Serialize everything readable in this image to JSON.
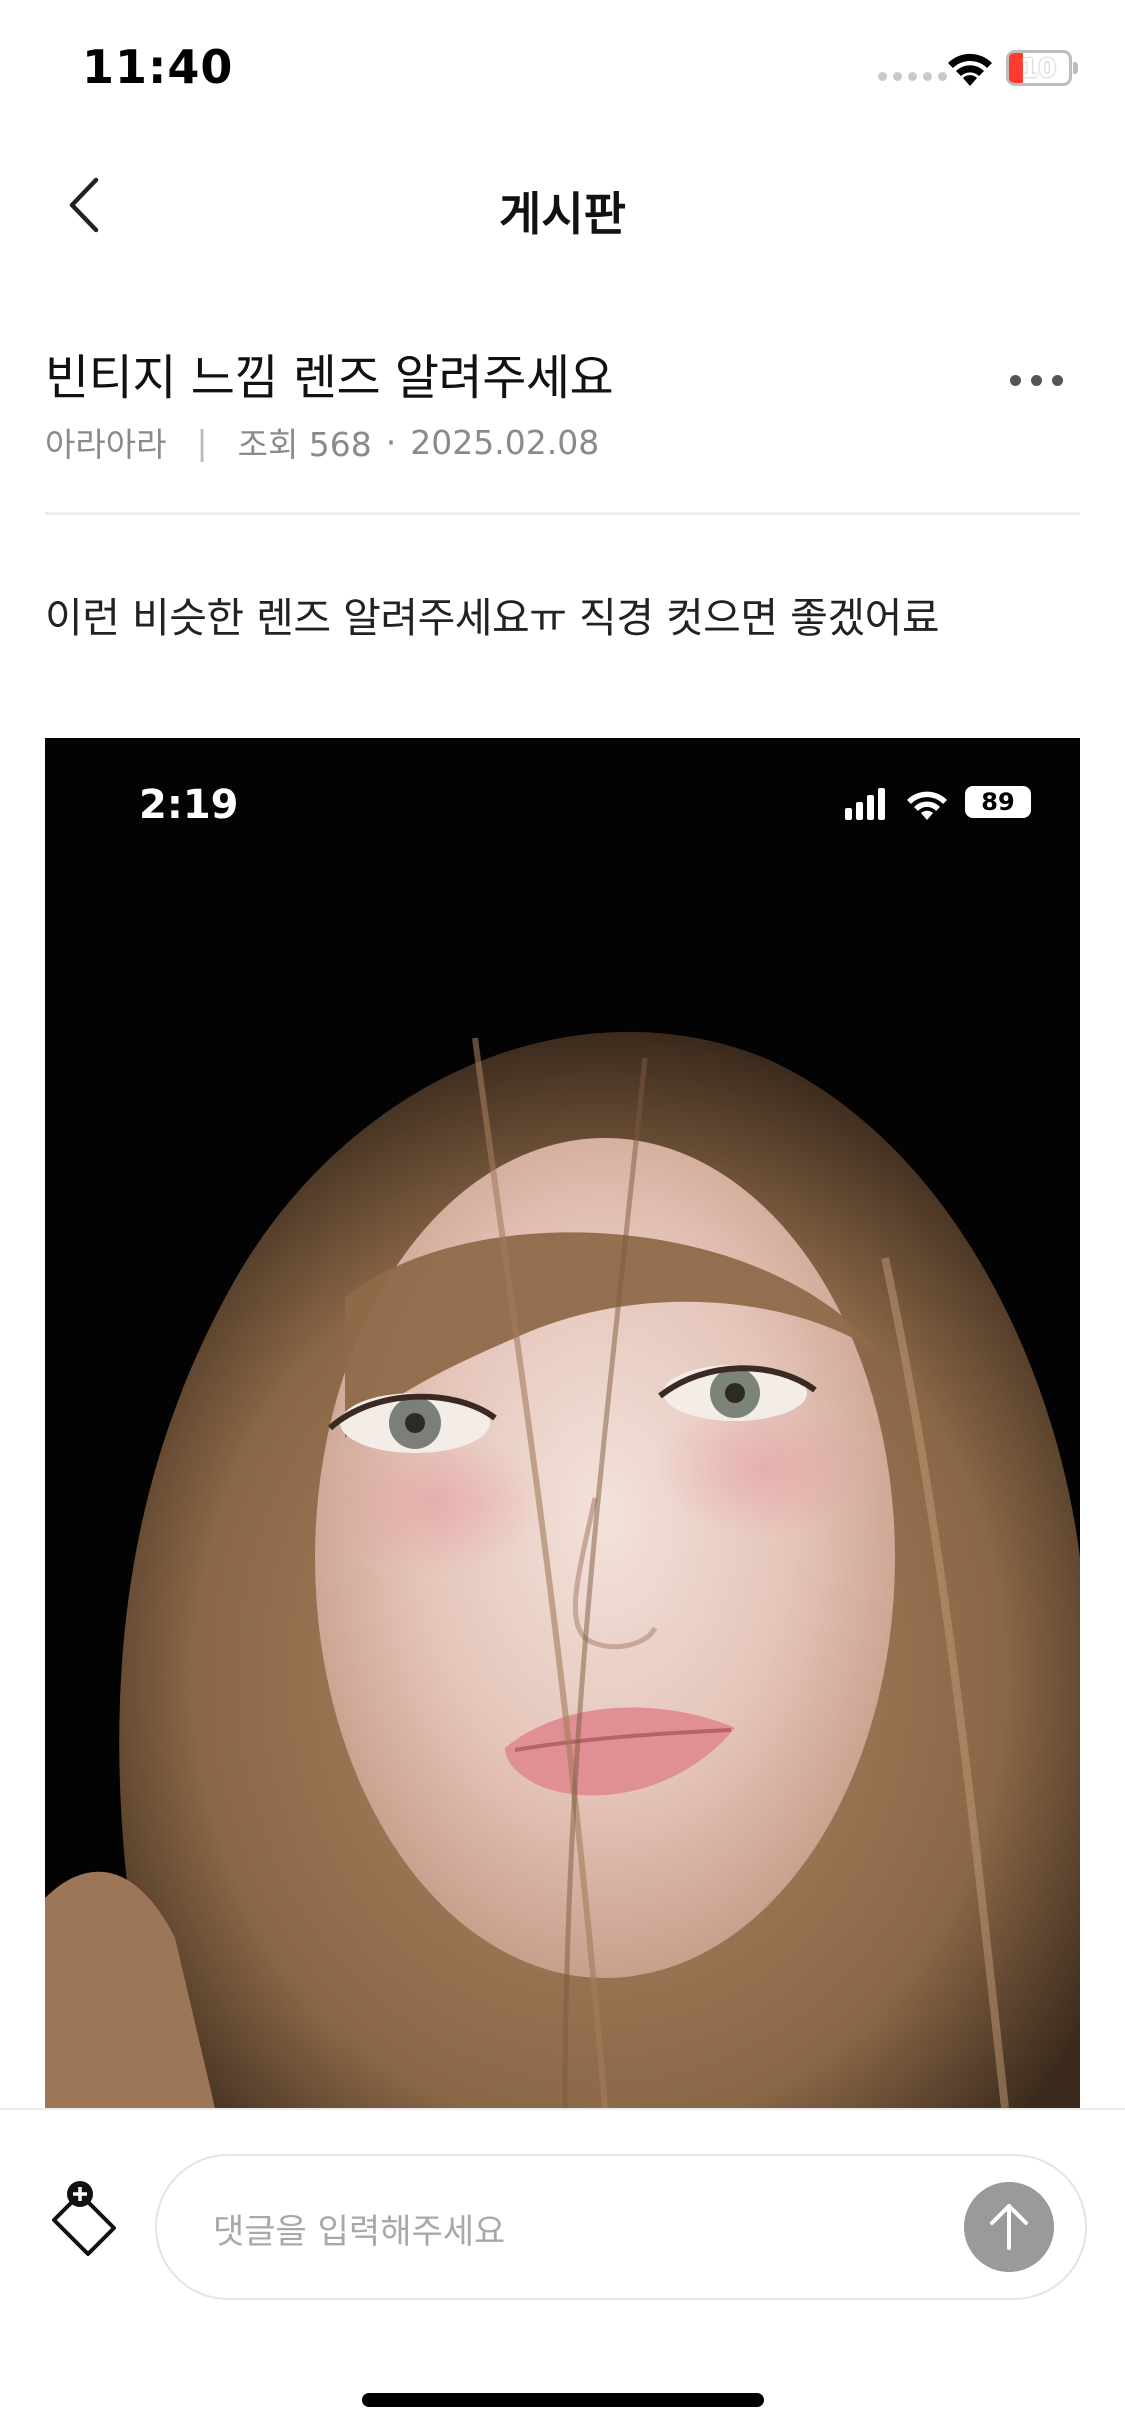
{
  "status_bar": {
    "time": "11:40",
    "battery_level": "10",
    "battery_color": "#ff3b30",
    "icons": [
      "signal-dots-icon",
      "wifi-icon",
      "battery-charging-icon"
    ]
  },
  "nav": {
    "title": "게시판",
    "back_icon": "chevron-left-icon"
  },
  "post": {
    "title": "빈티지 느낌 렌즈 알려주세요",
    "author": "아라아라",
    "separator": "|",
    "views": "조회 568",
    "dot": "·",
    "date": "2025.02.08",
    "body": "이런 비슷한 렌즈 알려주세요ㅠ 직경 컷으면 좋겠어료",
    "more_icon": "more-horizontal-icon"
  },
  "attached_photo": {
    "status_time": "2:19",
    "status_battery": "89",
    "description": "portrait photo with light brown hair"
  },
  "comment_bar": {
    "placeholder": "댓글을 입력해주세요",
    "tag_icon": "tag-add-icon",
    "send_icon": "arrow-up-icon"
  }
}
